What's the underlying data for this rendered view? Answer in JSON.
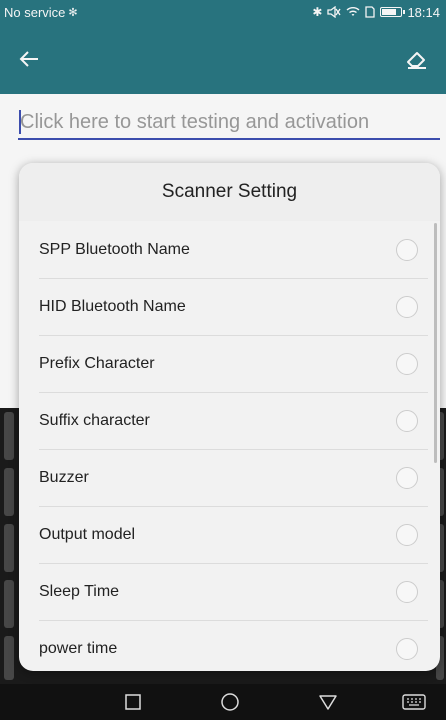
{
  "status_bar": {
    "carrier": "No service",
    "time": "18:14",
    "battery_level": 0.8
  },
  "toolbar": {
    "back_icon": "arrow-left-icon",
    "erase_icon": "eraser-icon"
  },
  "input": {
    "placeholder": "Click here to start testing and activation",
    "value": ""
  },
  "dialog": {
    "title": "Scanner Setting",
    "items": [
      {
        "label": "SPP Bluetooth Name",
        "selected": false
      },
      {
        "label": "HID Bluetooth Name",
        "selected": false
      },
      {
        "label": "Prefix Character",
        "selected": false
      },
      {
        "label": "Suffix character",
        "selected": false
      },
      {
        "label": "Buzzer",
        "selected": false
      },
      {
        "label": "Output model",
        "selected": false
      },
      {
        "label": "Sleep Time",
        "selected": false
      },
      {
        "label": "power time",
        "selected": false
      }
    ]
  },
  "navbar": {
    "recents_icon": "square-icon",
    "home_icon": "circle-icon",
    "back_icon": "triangle-icon",
    "keyboard_icon": "keyboard-icon"
  },
  "colors": {
    "primary": "#2a7884",
    "accent": "#3f51b5"
  }
}
